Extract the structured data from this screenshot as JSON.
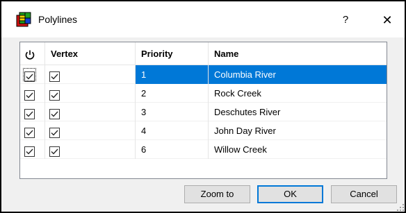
{
  "window": {
    "title": "Polylines",
    "help_label": "?",
    "close_label": "✕",
    "app_icon": "grid-app-icon"
  },
  "table": {
    "columns": [
      "",
      "Vertex",
      "Priority",
      "Name"
    ],
    "enabled_column_icon": "power-icon",
    "rows": [
      {
        "enabled": true,
        "vertex": true,
        "priority": "1",
        "name": "Columbia River",
        "selected": true
      },
      {
        "enabled": true,
        "vertex": true,
        "priority": "2",
        "name": "Rock Creek",
        "selected": false
      },
      {
        "enabled": true,
        "vertex": true,
        "priority": "3",
        "name": "Deschutes River",
        "selected": false
      },
      {
        "enabled": true,
        "vertex": true,
        "priority": "4",
        "name": "John Day River",
        "selected": false
      },
      {
        "enabled": true,
        "vertex": true,
        "priority": "6",
        "name": "Willow Creek",
        "selected": false
      }
    ]
  },
  "buttons": {
    "zoom_to": "Zoom to",
    "ok": "OK",
    "cancel": "Cancel"
  },
  "colors": {
    "selection": "#0078d7",
    "window_bg": "#f0f0f0"
  }
}
